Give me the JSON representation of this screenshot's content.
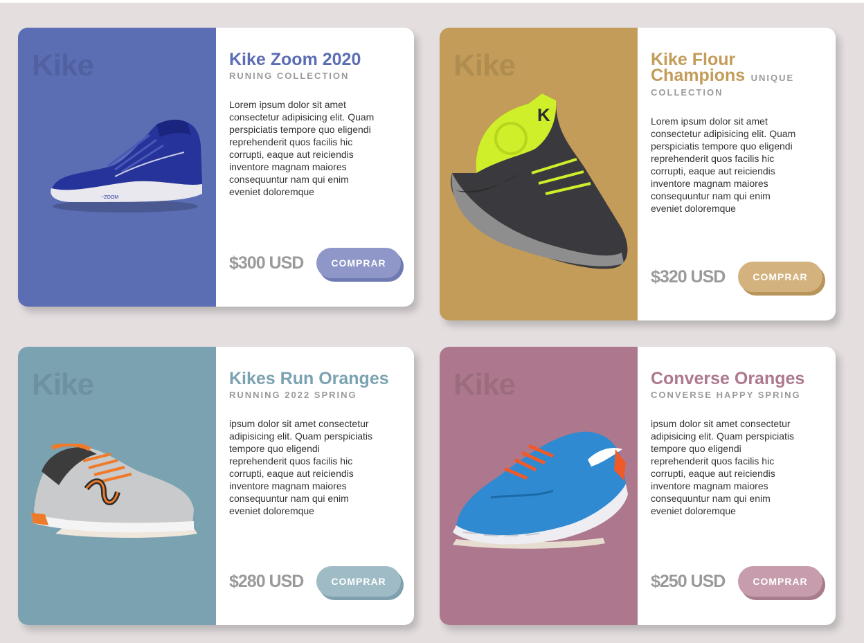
{
  "cards": [
    {
      "brand": "Kike",
      "title": "Kike Zoom 2020",
      "subtitle": "RUNING COLLECTION",
      "description": "Lorem ipsum dolor sit amet consectetur adipisicing elit. Quam perspiciatis tempore quo eligendi reprehenderit quos facilis hic corrupti, eaque aut reiciendis inventore magnam maiores consequuntur nam qui enim eveniet doloremque",
      "price": "$300 USD",
      "button": "COMPRAR",
      "color": "#5b6db3",
      "button_color": "#8e97c8",
      "shoe": "blue-basketball-shoe"
    },
    {
      "brand": "Kike",
      "title": "Kike Flour Champions",
      "subtitle": "UNIQUE COLLECTION",
      "description": "Lorem ipsum dolor sit amet consectetur adipisicing elit. Quam perspiciatis tempore quo eligendi reprehenderit quos facilis hic corrupti, eaque aut reiciendis inventore magnam maiores consequuntur nam qui enim eveniet doloremque",
      "price": "$320 USD",
      "button": "COMPRAR",
      "color": "#c39c59",
      "button_color": "#d3b27e",
      "shoe": "volt-high-top-shoe"
    },
    {
      "brand": "Kike",
      "title": "Kikes Run Oranges",
      "subtitle": "RUNNING 2022 SPRING",
      "description": "ipsum dolor sit amet consectetur adipisicing elit. Quam perspiciatis tempore quo eligendi reprehenderit quos facilis hic corrupti, eaque aut reiciendis inventore magnam maiores consequuntur nam qui enim eveniet doloremque",
      "price": "$280 USD",
      "button": "COMPRAR",
      "color": "#7aa2b1",
      "button_color": "#9fbcc6",
      "shoe": "silver-orange-running-shoe"
    },
    {
      "brand": "Kike",
      "title": "Converse Oranges",
      "subtitle": "CONVERSE HAPPY SPRING",
      "description": "ipsum dolor sit amet consectetur adipisicing elit. Quam perspiciatis tempore quo eligendi reprehenderit quos facilis hic corrupti, eaque aut reiciendis inventore magnam maiores consequuntur nam qui enim eveniet doloremque",
      "price": "$250 USD",
      "button": "COMPRAR",
      "color": "#ad788d",
      "button_color": "#c79cac",
      "shoe": "blue-running-shoe"
    }
  ]
}
